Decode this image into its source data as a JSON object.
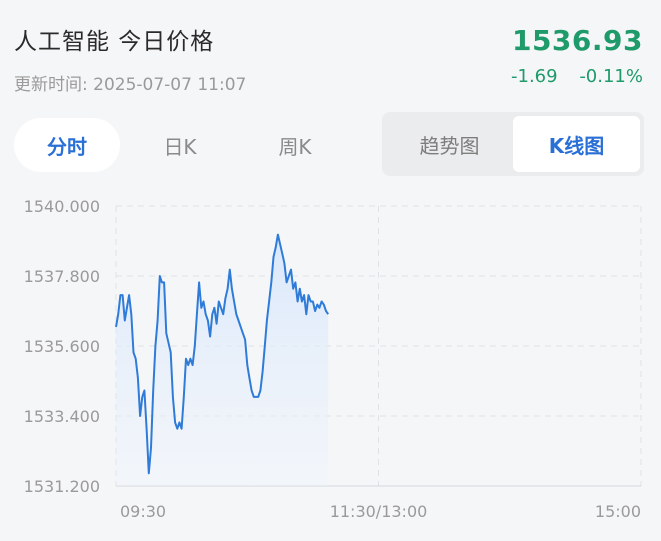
{
  "header": {
    "title": "人工智能 今日价格",
    "update_time": "更新时间: 2025-07-07 11:07",
    "price": "1536.93",
    "change": "-1.69",
    "change_pct": "-0.11%"
  },
  "tabs": [
    {
      "label": "分时",
      "active": true
    },
    {
      "label": "日K",
      "active": false
    },
    {
      "label": "周K",
      "active": false
    }
  ],
  "view_toggle": [
    {
      "label": "趋势图",
      "active": false
    },
    {
      "label": "K线图",
      "active": true
    }
  ],
  "colors": {
    "line": "#2f7bd8",
    "up_down_green": "#1f9a6a",
    "accent_blue": "#2a6fd6"
  },
  "chart_data": {
    "type": "area",
    "y_ticks": [
      "1540.000",
      "1537.800",
      "1535.600",
      "1533.400",
      "1531.200"
    ],
    "ylim": [
      1531.2,
      1540.0
    ],
    "x_ticks": [
      "09:30",
      "11:30/13:00",
      "15:00"
    ],
    "x_minutes_total": 240,
    "grid": true,
    "series": [
      {
        "x": [
          0,
          1,
          2,
          3,
          4,
          5,
          6,
          7,
          8,
          9,
          10,
          11,
          12,
          13,
          14,
          15,
          16,
          17,
          18,
          19,
          20,
          21,
          22,
          23,
          24,
          25,
          26,
          27,
          28,
          29,
          30,
          31,
          32,
          33,
          34,
          35,
          36,
          37,
          38,
          39,
          40,
          41,
          42,
          43,
          44,
          45,
          46,
          47,
          48,
          49,
          50,
          51,
          52,
          53,
          54,
          55,
          56,
          57,
          58,
          59,
          60,
          61,
          62,
          63,
          64,
          65,
          66,
          67,
          68,
          69,
          70,
          71,
          72,
          73,
          74,
          75,
          76,
          77,
          78,
          79,
          80,
          81,
          82,
          83,
          84,
          85,
          86,
          87,
          88,
          89,
          90,
          91,
          92,
          93,
          94,
          95,
          96,
          97
        ],
        "values": [
          1536.2,
          1536.6,
          1537.2,
          1537.2,
          1536.4,
          1536.8,
          1537.2,
          1536.6,
          1535.4,
          1535.2,
          1534.6,
          1533.4,
          1534.0,
          1534.2,
          1533.0,
          1531.6,
          1532.4,
          1534.2,
          1535.6,
          1536.4,
          1537.8,
          1537.6,
          1537.6,
          1536.0,
          1535.7,
          1535.4,
          1534.0,
          1533.2,
          1533.0,
          1533.2,
          1533.0,
          1534.0,
          1535.2,
          1535.0,
          1535.2,
          1535.0,
          1535.6,
          1536.6,
          1537.6,
          1536.8,
          1537.0,
          1536.6,
          1536.4,
          1535.9,
          1536.6,
          1536.8,
          1536.3,
          1537.0,
          1536.8,
          1536.6,
          1537.1,
          1537.4,
          1538.0,
          1537.4,
          1537.0,
          1536.6,
          1536.4,
          1536.2,
          1536.0,
          1535.8,
          1535.0,
          1534.6,
          1534.2,
          1534.0,
          1534.0,
          1534.0,
          1534.2,
          1534.8,
          1535.6,
          1536.4,
          1537.0,
          1537.6,
          1538.4,
          1538.7,
          1539.1,
          1538.8,
          1538.5,
          1538.2,
          1537.6,
          1537.8,
          1538.0,
          1537.4,
          1537.6,
          1537.0,
          1537.4,
          1537.0,
          1537.2,
          1536.6,
          1537.2,
          1537.0,
          1537.0,
          1536.7,
          1536.9,
          1536.8,
          1537.0,
          1536.9,
          1536.7,
          1536.6
        ]
      }
    ]
  }
}
